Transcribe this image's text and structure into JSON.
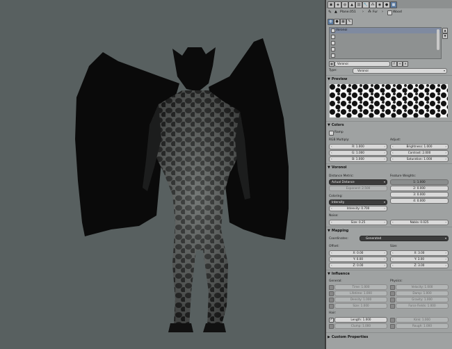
{
  "toolbar": {
    "object_name": "Plane.051",
    "particle_label": "Fur",
    "texture_mode_label": "Wood",
    "context_tabs": [
      "render-icon",
      "scene-icon",
      "world-icon",
      "object-icon",
      "constraint-icon",
      "modifier-icon",
      "particles-icon",
      "physics-icon",
      "material-icon",
      "texture-icon"
    ]
  },
  "texture_slots": {
    "items": [
      "Voronoi",
      "",
      "",
      "",
      ""
    ],
    "selected_name": "Voronoi"
  },
  "type_row": {
    "label": "Type:",
    "value": "Voronoi"
  },
  "preview": {
    "title": "Preview"
  },
  "colors": {
    "title": "Colors",
    "ramp_label": "Ramp",
    "rgb_label": "RGB Multiply:",
    "adjust_label": "Adjust:",
    "r": "R: 1.000",
    "g": "G: 1.000",
    "b": "B: 1.000",
    "brightness": "Brightness: 1.000",
    "contrast": "Contrast: 2.000",
    "saturation": "Saturation: 1.000"
  },
  "voronoi": {
    "title": "Voronoi",
    "distance_label": "Distance Metric:",
    "distance_value": "Actual Distance",
    "exponent": "Exponent: 2.500",
    "feature_label": "Feature Weights:",
    "weights": [
      "1: 1.000",
      "2: 0.000",
      "3: 0.000",
      "4: 0.000"
    ],
    "weight_levels": [
      1.0,
      0.0,
      0.0,
      0.0
    ],
    "coloring_label": "Coloring:",
    "coloring_value": "Intensity",
    "intensity": "Intensity: 0.700",
    "noise_label": "Noise:",
    "size": "Size: 0.25",
    "nabla": "Nabla: 0.025"
  },
  "mapping": {
    "title": "Mapping",
    "coords_label": "Coordinates:",
    "coords_value": "Generated",
    "offset_label": "Offset:",
    "size_label": "Size:",
    "ox": "X: 0.00",
    "oy": "Y: 0.00",
    "oz": "Z: 0.00",
    "sx": "X: 3.00",
    "sy": "Y: 3.00",
    "sz": "Z: 3.00"
  },
  "influence": {
    "title": "Influence",
    "general_label": "General:",
    "physics_label": "Physics:",
    "time": "Time: 1.000",
    "lifetime": "Lifetime: 1.000",
    "density": "Density: 1.000",
    "size": "Size: 1.000",
    "velocity": "Velocity: 1.000",
    "damp": "Damp: 1.000",
    "gravity": "Gravity: 1.000",
    "force_fields": "Force Fields: 1.000",
    "hair_label": "Hair:",
    "length": "Length: 1.000",
    "clump": "Clump: 1.000",
    "kink": "Kink: 1.000",
    "rough": "Rough: 1.000"
  },
  "custom_properties": {
    "title": "Custom Properties"
  }
}
